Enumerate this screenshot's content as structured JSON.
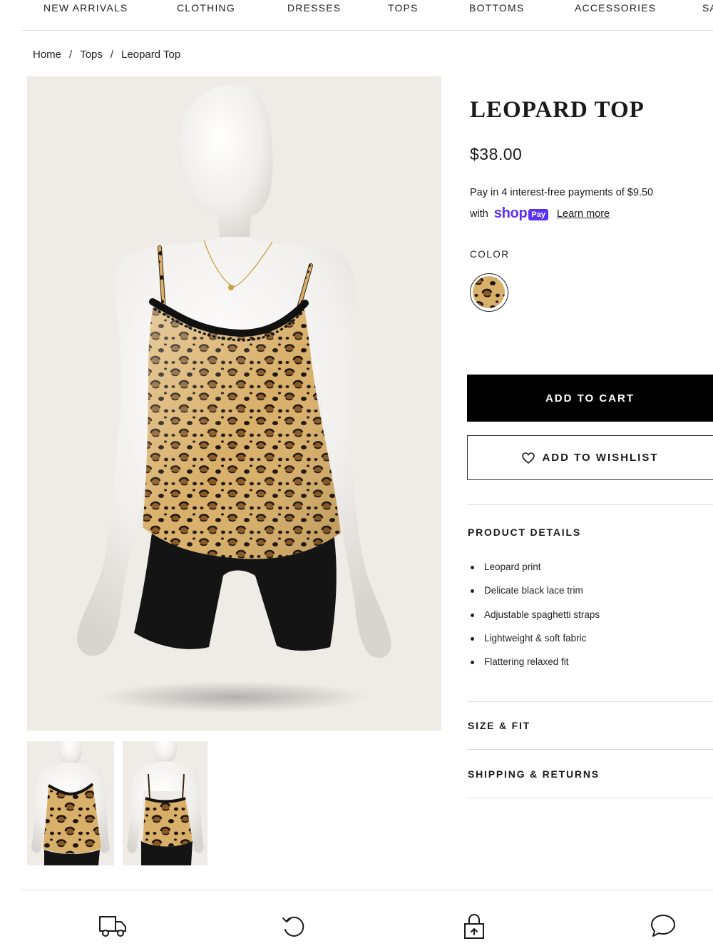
{
  "nav": {
    "items": [
      "NEW ARRIVALS",
      "CLOTHING",
      "DRESSES",
      "TOPS",
      "BOTTOMS",
      "ACCESSORIES",
      "SA"
    ]
  },
  "breadcrumb": {
    "home": "Home",
    "category": "Tops",
    "current": "Leopard Top",
    "separator": "/"
  },
  "product": {
    "title": "LEOPARD TOP",
    "price": "$38.00",
    "installment_text": "Pay in 4 interest-free payments of $9.50",
    "with_text": "with",
    "shop_word": "shop",
    "pay_badge": "Pay",
    "learn_more": "Learn more",
    "color_label": "COLOR",
    "add_to_cart": "ADD TO CART",
    "add_to_wishlist": "ADD TO WISHLIST"
  },
  "details": {
    "heading": "PRODUCT DETAILS",
    "items": [
      "Leopard print",
      "Delicate black lace trim",
      "Adjustable spaghetti straps",
      "Lightweight & soft fabric",
      "Flattering relaxed fit"
    ]
  },
  "accordions": {
    "size_fit": "SIZE & FIT",
    "shipping_returns": "SHIPPING & RETURNS"
  },
  "bottom_icons": [
    "truck-icon",
    "returns-icon",
    "lock-icon",
    "chat-icon"
  ],
  "colors": {
    "shop_pay_purple": "#5a31f4",
    "button_black": "#000000",
    "image_bg": "#efebe7",
    "leopard_base": "#d9b06a",
    "leopard_spot": "#1c140c",
    "leopard_ring": "#7a4a1c"
  }
}
